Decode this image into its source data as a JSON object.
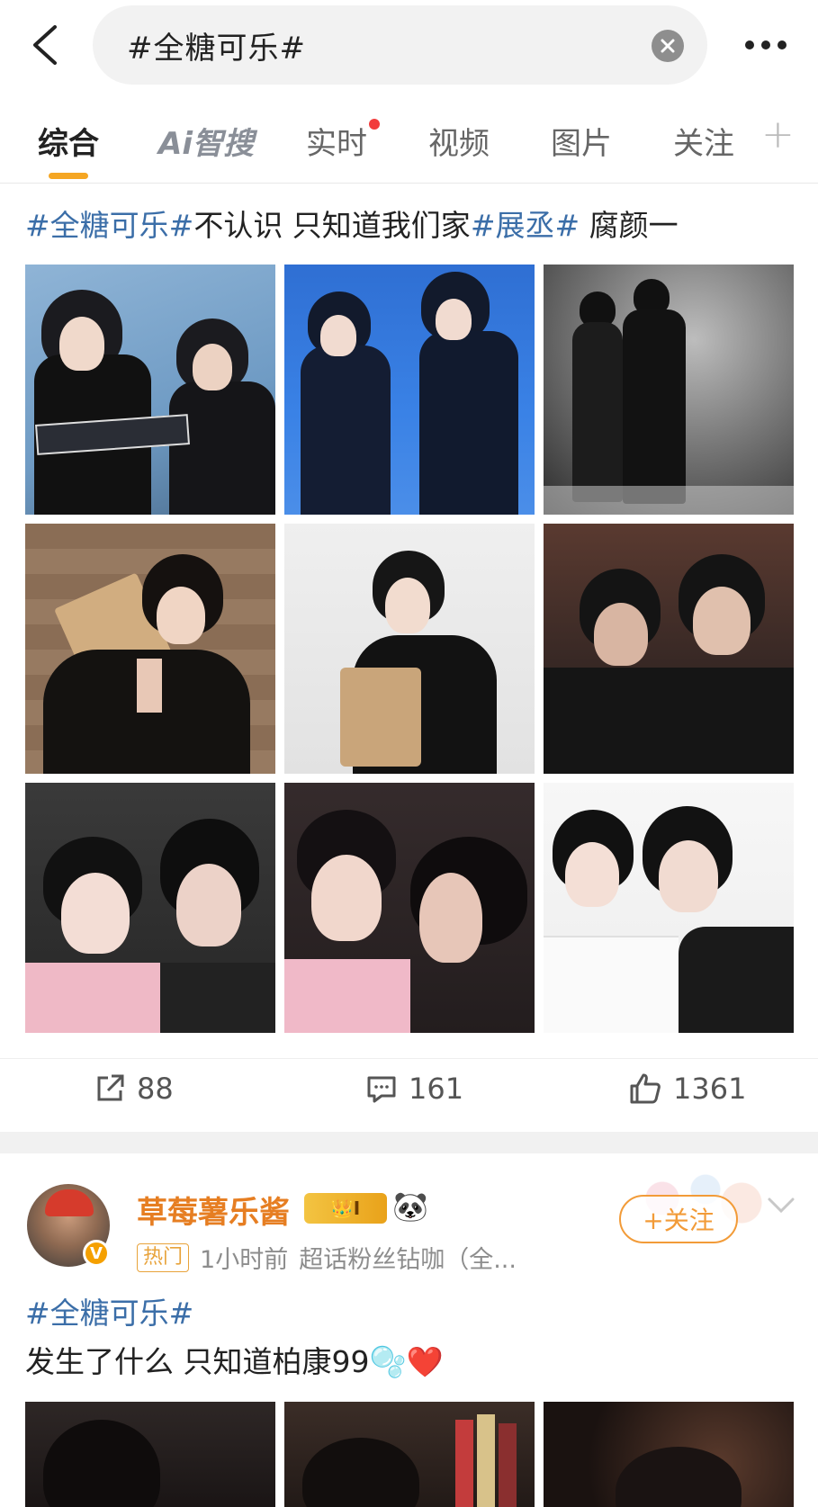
{
  "search": {
    "query": "#全糖可乐#"
  },
  "tabs": [
    {
      "label": "综合"
    },
    {
      "label": "Ai智搜"
    },
    {
      "label": "实时"
    },
    {
      "label": "视频"
    },
    {
      "label": "图片"
    },
    {
      "label": "关注"
    }
  ],
  "post1": {
    "text": {
      "tag1": "#全糖可乐#",
      "mid": "不认识 只知道我们家",
      "tag2": "#展丞#",
      "end": " 腐颜一"
    },
    "images": [
      "photo-1",
      "photo-2",
      "photo-3",
      "photo-4",
      "photo-5",
      "photo-6",
      "photo-7",
      "photo-8",
      "photo-9"
    ],
    "actions": {
      "share": "88",
      "comment": "161",
      "like": "1361"
    }
  },
  "post2": {
    "author": "草莓薯乐酱",
    "level_badge": "I",
    "hot_label": "热门",
    "time": "1小时前",
    "source": "超话粉丝钻咖（全...",
    "follow_label": "+关注",
    "tag": "#全糖可乐#",
    "text": "发生了什么 只知道柏康99🫧❤️"
  },
  "colors": {
    "accent": "#f5a623",
    "tag": "#3b6ea8",
    "author": "#e67e22"
  }
}
